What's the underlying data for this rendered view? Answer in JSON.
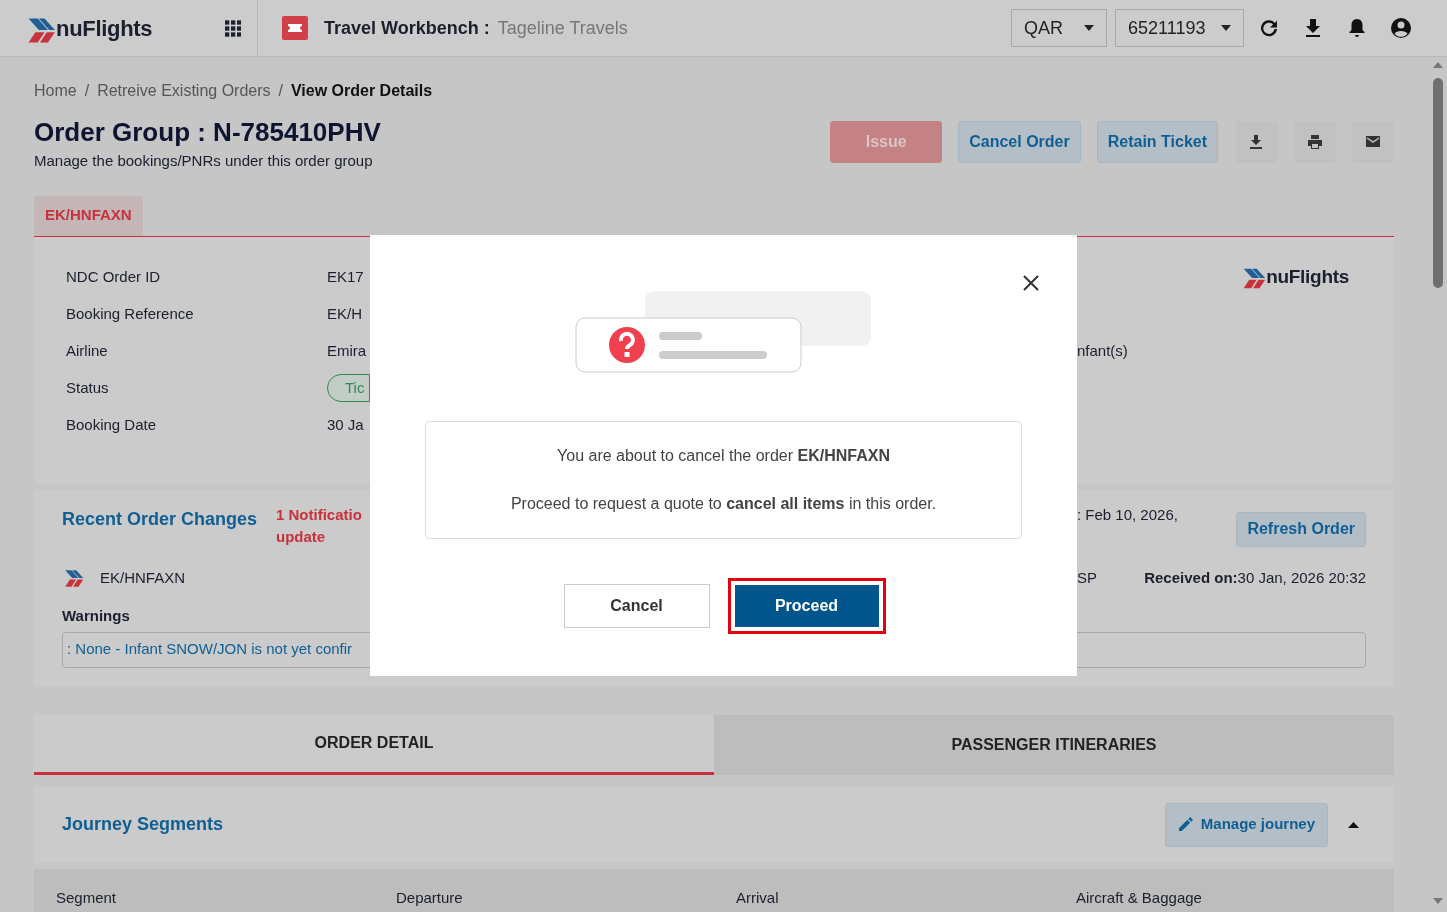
{
  "header": {
    "logo_text": "nuFlights",
    "title": "Travel Workbench :",
    "subtitle": "Tageline Travels",
    "currency": "QAR",
    "account": "65211193"
  },
  "breadcrumb": [
    {
      "label": "Home",
      "current": false
    },
    {
      "separator": "/",
      "label": "Retreive Existing Orders",
      "current": false
    },
    {
      "separator": "/",
      "label": "View Order Details",
      "current": true
    }
  ],
  "page": {
    "title": "Order Group : N-785410PHV",
    "subtitle": "Manage the bookings/PNRs under this order group"
  },
  "actions": [
    {
      "label": "Issue",
      "kind": "danger",
      "disabled": true
    },
    {
      "label": "Cancel Order",
      "kind": "secondary",
      "disabled": false
    },
    {
      "label": "Retain Ticket",
      "kind": "secondary",
      "disabled": false
    }
  ],
  "booking_tabs": [
    {
      "label": "EK/HNFAXN",
      "selected": true
    }
  ],
  "order_info": {
    "fields": [
      {
        "label": "NDC Order ID",
        "value": "EK17",
        "kind": "text"
      },
      {
        "label": "Booking Reference",
        "value": "EK/H",
        "kind": "text"
      },
      {
        "label": "Airline",
        "value": "Emira",
        "kind": "text"
      },
      {
        "label": "Status",
        "value": "Tic",
        "kind": "badge"
      },
      {
        "label": "Booking Date",
        "value": "30 Ja",
        "kind": "text"
      }
    ],
    "passengers": "nfant(s)",
    "logo_text": "nuFlights"
  },
  "recent_changes": {
    "title": "Recent Order Changes",
    "notification_lines": [
      "1 Notificatio",
      "update"
    ],
    "updated": ": Feb 10, 2026,",
    "refresh_button": "Refresh Order",
    "booking_ref": "EK/HNFAXN",
    "status": "SP",
    "received": "**Received on:**30 Jan, 2026 20:32",
    "warnings_title": "Warnings",
    "warning": ": None - Infant SNOW/JON is not yet confir"
  },
  "detail_tabs": [
    {
      "label": "ORDER DETAIL",
      "selected": true
    },
    {
      "label": "PASSENGER ITINERARIES",
      "selected": false
    }
  ],
  "journey": {
    "title": "Journey Segments",
    "manage_button": "Manage journey",
    "expanded": true,
    "columns": [
      "Segment",
      "Departure",
      "Arrival",
      "Aircraft & Baggage"
    ]
  },
  "modal": {
    "message": "You are about to cancel the order **EK/HNFAXN**",
    "detail": "Proceed to request a quote to **cancel all items** in this order.",
    "buttons": [
      {
        "label": "Cancel",
        "kind": "secondary",
        "highlighted": false
      },
      {
        "label": "Proceed",
        "kind": "primary",
        "highlighted": true
      }
    ]
  }
}
